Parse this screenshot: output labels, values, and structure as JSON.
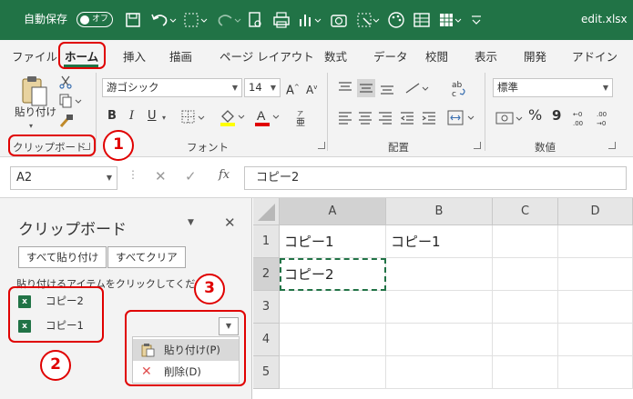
{
  "titlebar": {
    "autosave_label": "自動保存",
    "autosave_state": "オフ",
    "filename": "edit.xlsx"
  },
  "tabs": [
    "ファイル",
    "ホーム",
    "挿入",
    "描画",
    "ページ レイアウト",
    "数式",
    "データ",
    "校閲",
    "表示",
    "開発",
    "アドイン"
  ],
  "ribbon": {
    "clipboard": {
      "paste_label": "貼り付け",
      "group_label": "クリップボード"
    },
    "font": {
      "name": "游ゴシック",
      "size": "14",
      "bold": "B",
      "italic": "I",
      "underline": "U",
      "group_label": "フォント"
    },
    "alignment": {
      "group_label": "配置"
    },
    "number": {
      "format": "標準",
      "percent": "%",
      "comma": "9",
      "group_label": "数値"
    }
  },
  "formula_bar": {
    "name_box": "A2",
    "fx": "fx",
    "formula": "コピー2"
  },
  "clipboard_pane": {
    "title": "クリップボード",
    "paste_all": "すべて貼り付け",
    "clear_all": "すべてクリア",
    "hint": "貼り付けるアイテムをクリックしてください。",
    "items": [
      {
        "label": "コピー2"
      },
      {
        "label": "コピー1"
      }
    ],
    "menu": [
      {
        "label": "貼り付け(P)"
      },
      {
        "label": "削除(D)"
      }
    ]
  },
  "grid": {
    "columns": [
      "A",
      "B",
      "C",
      "D"
    ],
    "rows": [
      "1",
      "2",
      "3",
      "4",
      "5"
    ],
    "cells": {
      "A1": "コピー1",
      "B1": "コピー1",
      "A2": "コピー2"
    }
  },
  "annotations": [
    "1",
    "2",
    "3"
  ],
  "colors": {
    "accent": "#217346",
    "annotation": "#e00000"
  }
}
